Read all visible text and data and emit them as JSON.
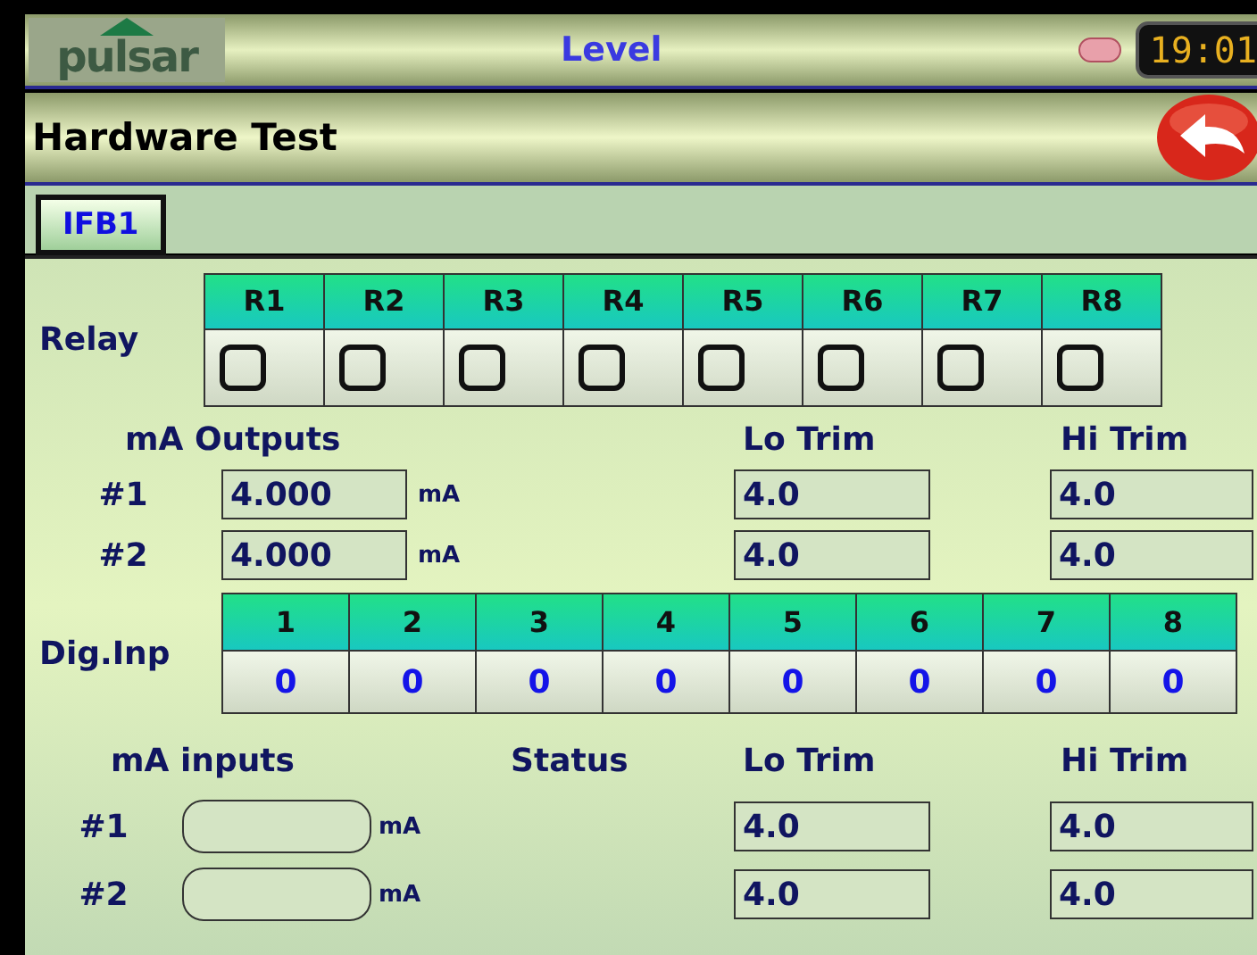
{
  "header": {
    "logo": "pulsar",
    "title": "Level",
    "indicator_on": false,
    "clock": "19:01"
  },
  "page_title": "Hardware Test",
  "tabs": [
    {
      "label": "IFB1",
      "selected": true
    }
  ],
  "relay": {
    "label": "Relay",
    "items": [
      {
        "label": "R1",
        "checked": false
      },
      {
        "label": "R2",
        "checked": false
      },
      {
        "label": "R3",
        "checked": false
      },
      {
        "label": "R4",
        "checked": false
      },
      {
        "label": "R5",
        "checked": false
      },
      {
        "label": "R6",
        "checked": false
      },
      {
        "label": "R7",
        "checked": false
      },
      {
        "label": "R8",
        "checked": false
      }
    ]
  },
  "ma_outputs": {
    "heading": "mA Outputs",
    "lo_heading": "Lo Trim",
    "hi_heading": "Hi Trim",
    "rows": [
      {
        "label": "#1",
        "value": "4.000",
        "unit": "mA",
        "lo": "4.0",
        "hi": "4.0"
      },
      {
        "label": "#2",
        "value": "4.000",
        "unit": "mA",
        "lo": "4.0",
        "hi": "4.0"
      }
    ]
  },
  "dig_inp": {
    "label": "Dig.Inp",
    "items": [
      {
        "label": "1",
        "value": "0"
      },
      {
        "label": "2",
        "value": "0"
      },
      {
        "label": "3",
        "value": "0"
      },
      {
        "label": "4",
        "value": "0"
      },
      {
        "label": "5",
        "value": "0"
      },
      {
        "label": "6",
        "value": "0"
      },
      {
        "label": "7",
        "value": "0"
      },
      {
        "label": "8",
        "value": "0"
      }
    ]
  },
  "ma_inputs": {
    "heading": "mA inputs",
    "status_heading": "Status",
    "lo_heading": "Lo Trim",
    "hi_heading": "Hi Trim",
    "rows": [
      {
        "label": "#1",
        "unit": "mA",
        "lo": "4.0",
        "hi": "4.0"
      },
      {
        "label": "#2",
        "unit": "mA",
        "lo": "4.0",
        "hi": "4.0"
      }
    ]
  }
}
